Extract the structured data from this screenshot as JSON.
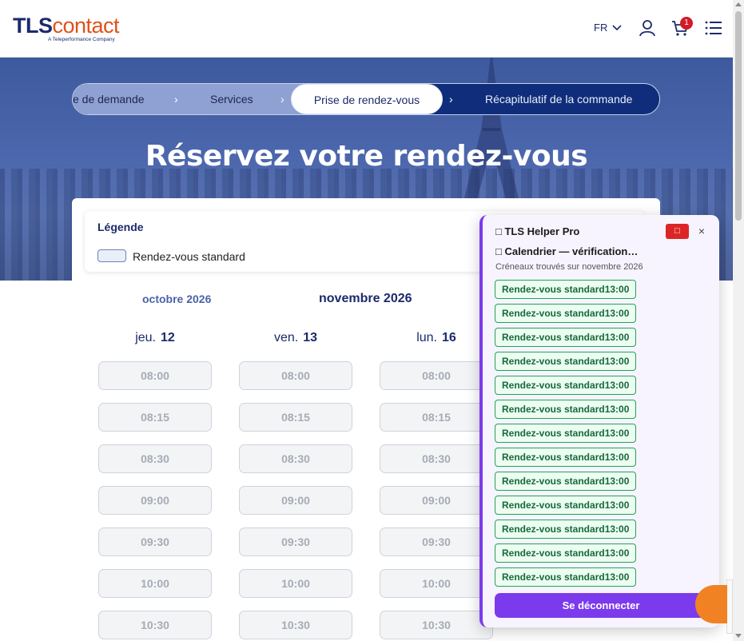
{
  "header": {
    "logo_tls": "TLS",
    "logo_contact": "contact",
    "logo_tagline": "A Teleperformance Company",
    "language": "FR",
    "cart_count": "1",
    "icons": [
      "user-icon",
      "cart-icon",
      "menu-icon"
    ]
  },
  "stepper": {
    "steps": [
      "e de demande",
      "Services",
      "Prise de rendez-vous",
      "Récapitulatif de la commande"
    ],
    "active_step": "Prise de rendez-vous"
  },
  "page_title": "Réservez votre rendez-vous",
  "legend": {
    "title": "Légende",
    "items": [
      "Rendez-vous standard"
    ]
  },
  "calendar": {
    "prev_month": "octobre 2026",
    "current_month": "novembre 2026",
    "days": [
      {
        "dow": "jeu.",
        "num": "12"
      },
      {
        "dow": "ven.",
        "num": "13"
      },
      {
        "dow": "lun.",
        "num": "16"
      }
    ],
    "times": [
      "08:00",
      "08:15",
      "08:30",
      "09:00",
      "09:30",
      "10:00",
      "10:30"
    ]
  },
  "helper_panel": {
    "title": "TLS Helper Pro",
    "status": "Calendrier — vérification…",
    "subtitle": "Créneaux trouvés sur novembre 2026",
    "found_slots": [
      "Rendez-vous standard13:00",
      "Rendez-vous standard13:00",
      "Rendez-vous standard13:00",
      "Rendez-vous standard13:00",
      "Rendez-vous standard13:00",
      "Rendez-vous standard13:00",
      "Rendez-vous standard13:00",
      "Rendez-vous standard13:00",
      "Rendez-vous standard13:00",
      "Rendez-vous standard13:00",
      "Rendez-vous standard13:00",
      "Rendez-vous standard13:00",
      "Rendez-vous standard13:00"
    ],
    "close_label": "×",
    "logout_label": "Se déconnecter"
  },
  "colors": {
    "brand_navy": "#1b2a6b",
    "brand_orange": "#e0501c",
    "panel_accent": "#7c3aed",
    "found_green": "#22a455"
  }
}
